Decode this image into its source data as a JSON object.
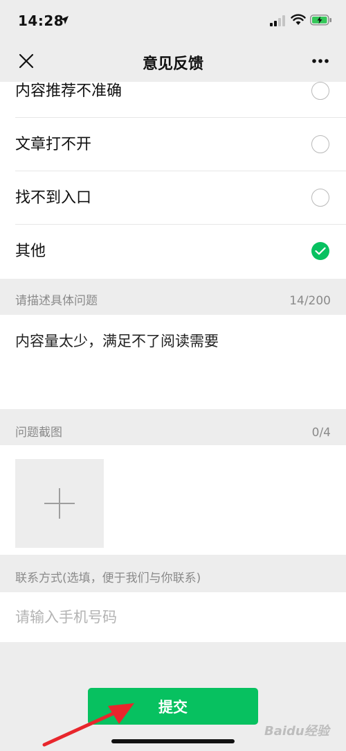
{
  "status_bar": {
    "time": "14:28"
  },
  "nav": {
    "title": "意见反馈"
  },
  "options": [
    {
      "label": "内容推荐不准确",
      "checked": false
    },
    {
      "label": "文章打不开",
      "checked": false
    },
    {
      "label": "找不到入口",
      "checked": false
    },
    {
      "label": "其他",
      "checked": true
    }
  ],
  "description": {
    "label": "请描述具体问题",
    "counter": "14/200",
    "value": "内容量太少，满足不了阅读需要"
  },
  "screenshot": {
    "label": "问题截图",
    "counter": "0/4"
  },
  "contact": {
    "label": "联系方式(选填，便于我们与你联系)",
    "placeholder": "请输入手机号码"
  },
  "submit": {
    "label": "提交"
  },
  "watermark": "Baidu经验",
  "colors": {
    "accent": "#07c160",
    "background": "#ededed",
    "annotation_arrow": "#e8262c"
  }
}
